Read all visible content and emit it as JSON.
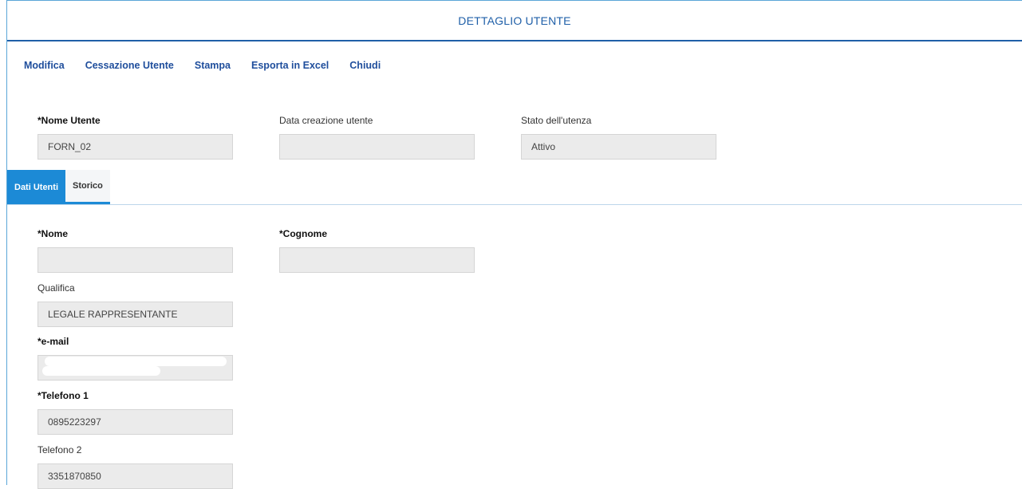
{
  "header": {
    "title": "DETTAGLIO UTENTE"
  },
  "toolbar": {
    "items": [
      "Modifica",
      "Cessazione Utente",
      "Stampa",
      "Esporta in Excel",
      "Chiudi"
    ]
  },
  "account": {
    "nome_utente": {
      "label": "*Nome Utente",
      "value": "FORN_02"
    },
    "data_creazione": {
      "label": "Data creazione utente",
      "value": ""
    },
    "stato": {
      "label": "Stato dell'utenza",
      "value": "Attivo"
    }
  },
  "tabs": [
    {
      "label": "Dati Utenti",
      "active": true
    },
    {
      "label": "Storico",
      "active": false
    }
  ],
  "dati": {
    "nome": {
      "label": "*Nome",
      "value": ""
    },
    "cognome": {
      "label": "*Cognome",
      "value": ""
    },
    "qualifica": {
      "label": "Qualifica",
      "value": "LEGALE RAPPRESENTANTE"
    },
    "email": {
      "label": "*e-mail",
      "value": ""
    },
    "telefono1": {
      "label": "*Telefono 1",
      "value": "0895223297"
    },
    "telefono2": {
      "label": "Telefono 2",
      "value": "3351870850"
    }
  },
  "colors": {
    "accent": "#1f5fa8",
    "tab_active": "#1c8ad6",
    "field_bg": "#ebebeb"
  }
}
